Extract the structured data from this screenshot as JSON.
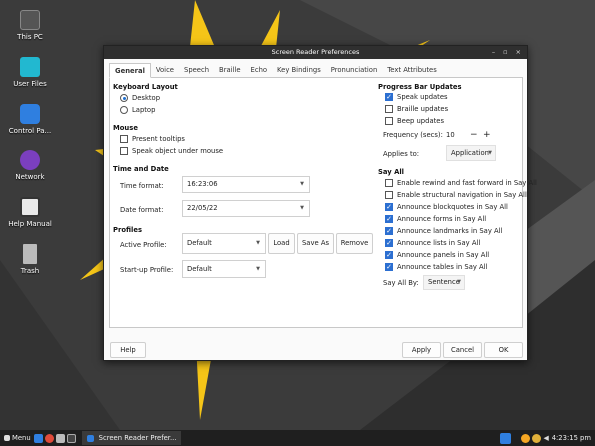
{
  "desktop": {
    "icons": [
      {
        "label": "This PC",
        "icon": "computer-icon"
      },
      {
        "label": "User Files",
        "icon": "folder-icon"
      },
      {
        "label": "Control Pa...",
        "icon": "control-panel-icon"
      },
      {
        "label": "Network",
        "icon": "network-icon"
      },
      {
        "label": "Help Manual",
        "icon": "help-book-icon"
      },
      {
        "label": "Trash",
        "icon": "trash-icon"
      }
    ]
  },
  "window": {
    "title": "Screen Reader Preferences",
    "controls": {
      "minimize": "–",
      "maximize": "▫",
      "close": "×"
    }
  },
  "tabs": [
    "General",
    "Voice",
    "Speech",
    "Braille",
    "Echo",
    "Key Bindings",
    "Pronunciation",
    "Text Attributes"
  ],
  "active_tab": "General",
  "general": {
    "keyboard_layout": {
      "title": "Keyboard Layout",
      "options": [
        {
          "label": "Desktop",
          "selected": true
        },
        {
          "label": "Laptop",
          "selected": false
        }
      ]
    },
    "mouse": {
      "title": "Mouse",
      "options": [
        {
          "label": "Present tooltips",
          "checked": false
        },
        {
          "label": "Speak object under mouse",
          "checked": false
        }
      ]
    },
    "time_date": {
      "title": "Time and Date",
      "time_label": "Time format:",
      "time_value": "16:23:06",
      "date_label": "Date format:",
      "date_value": "22/05/22"
    },
    "profiles": {
      "title": "Profiles",
      "active_label": "Active Profile:",
      "active_value": "Default",
      "startup_label": "Start-up Profile:",
      "startup_value": "Default",
      "load": "Load",
      "save_as": "Save As",
      "remove": "Remove"
    },
    "progress": {
      "title": "Progress Bar Updates",
      "options": [
        {
          "label": "Speak updates",
          "checked": true
        },
        {
          "label": "Braille updates",
          "checked": false
        },
        {
          "label": "Beep updates",
          "checked": false
        }
      ],
      "frequency_label": "Frequency (secs):",
      "frequency_value": "10",
      "applies_label": "Applies to:",
      "applies_value": "Application"
    },
    "say_all": {
      "title": "Say All",
      "options": [
        {
          "label": "Enable rewind and fast forward in Say All",
          "checked": false
        },
        {
          "label": "Enable structural navigation in Say All",
          "checked": false
        },
        {
          "label": "Announce blockquotes in Say All",
          "checked": true
        },
        {
          "label": "Announce forms in Say All",
          "checked": true
        },
        {
          "label": "Announce landmarks in Say All",
          "checked": true
        },
        {
          "label": "Announce lists in Say All",
          "checked": true
        },
        {
          "label": "Announce panels in Say All",
          "checked": true
        },
        {
          "label": "Announce tables in Say All",
          "checked": true
        }
      ],
      "by_label": "Say All By:",
      "by_value": "Sentence"
    }
  },
  "footer": {
    "help": "Help",
    "apply": "Apply",
    "cancel": "Cancel",
    "ok": "OK"
  },
  "taskbar": {
    "menu": "Menu",
    "task": "Screen Reader Prefer...",
    "clock": "4:23:15 pm"
  },
  "colors": {
    "accent": "#2c6fd1",
    "star": "#f5c518",
    "titlebar": "#2f2f2f"
  }
}
